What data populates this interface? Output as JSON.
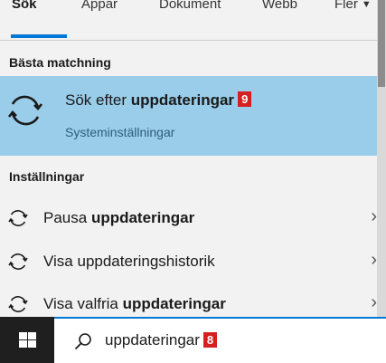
{
  "tabs": [
    {
      "label": "Sök",
      "active": true
    },
    {
      "label": "Appar"
    },
    {
      "label": "Dokument"
    },
    {
      "label": "Webb"
    },
    {
      "label": "Fler"
    }
  ],
  "best_match": {
    "header": "Bästa matchning",
    "title_prefix": "Sök efter ",
    "title_bold": "uppdateringar",
    "badge": "9",
    "subtitle": "Systeminställningar",
    "icon": "sync-icon"
  },
  "settings": {
    "header": "Inställningar",
    "items": [
      {
        "prefix": "Pausa ",
        "bold": "uppdateringar",
        "suffix": "",
        "icon": "sync-icon"
      },
      {
        "prefix": "Visa uppdateringshistorik",
        "bold": "",
        "suffix": "",
        "icon": "sync-icon"
      },
      {
        "prefix": "Visa valfria ",
        "bold": "uppdateringar",
        "suffix": "",
        "icon": "sync-icon"
      }
    ]
  },
  "search": {
    "value": "uppdateringar",
    "badge": "8",
    "icon": "search-icon"
  },
  "colors": {
    "accent": "#0078d7",
    "highlight": "#99cde9",
    "badge": "#d62020",
    "taskbar": "#1f1f1f"
  }
}
